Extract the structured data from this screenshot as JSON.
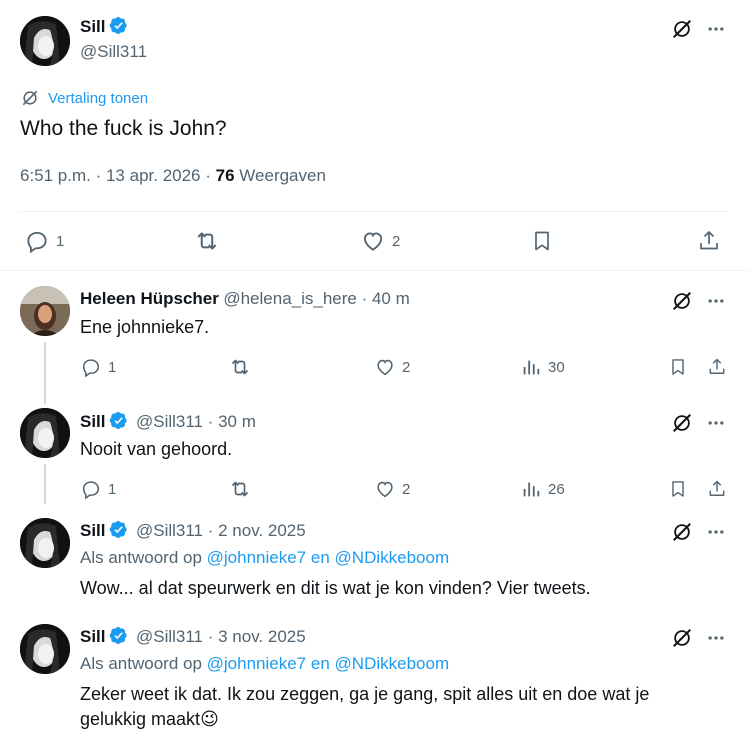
{
  "main_tweet": {
    "name": "Sill",
    "handle": "@Sill311",
    "translate_label": "Vertaling tonen",
    "text": "Who the fuck is John?",
    "time": "6:51 p.m. · 13 apr. 2026 ·",
    "views_count": "76",
    "views_label": "Weergaven",
    "replies": "1",
    "likes": "2"
  },
  "replies": [
    {
      "name": "Heleen Hüpscher",
      "handle": "@helena_is_here · 40 m",
      "text": "Ene johnnieke7.",
      "replies": "1",
      "likes": "2",
      "views": "30"
    },
    {
      "name": "Sill",
      "handle": "@Sill311 · 30 m",
      "text": "Nooit van gehoord.",
      "replies": "1",
      "likes": "2",
      "views": "26"
    },
    {
      "name": "Sill",
      "handle": "@Sill311 · 2 nov. 2025",
      "reply_to_prefix": "Als antwoord op",
      "reply_to_user1": "@johnnieke7",
      "reply_to_and": "en",
      "reply_to_user2": "@NDikkeboom",
      "text": "Wow... al dat speurwerk en dit is wat je kon vinden? Vier tweets."
    },
    {
      "name": "Sill",
      "handle": "@Sill311 · 3 nov. 2025",
      "reply_to_prefix": "Als antwoord op",
      "reply_to_user1": "@johnnieke7",
      "reply_to_and": "en",
      "reply_to_user2": "@NDikkeboom",
      "text_line1": "Zeker weet ik dat. Ik zou zeggen, ga je gang, spit alles uit en doe wat je",
      "text_line2": "gelukkig maakt",
      "emoji": "😉"
    }
  ],
  "colors": {
    "accent": "#1d9bf0",
    "text_primary": "#0f1419",
    "text_secondary": "#536471"
  }
}
